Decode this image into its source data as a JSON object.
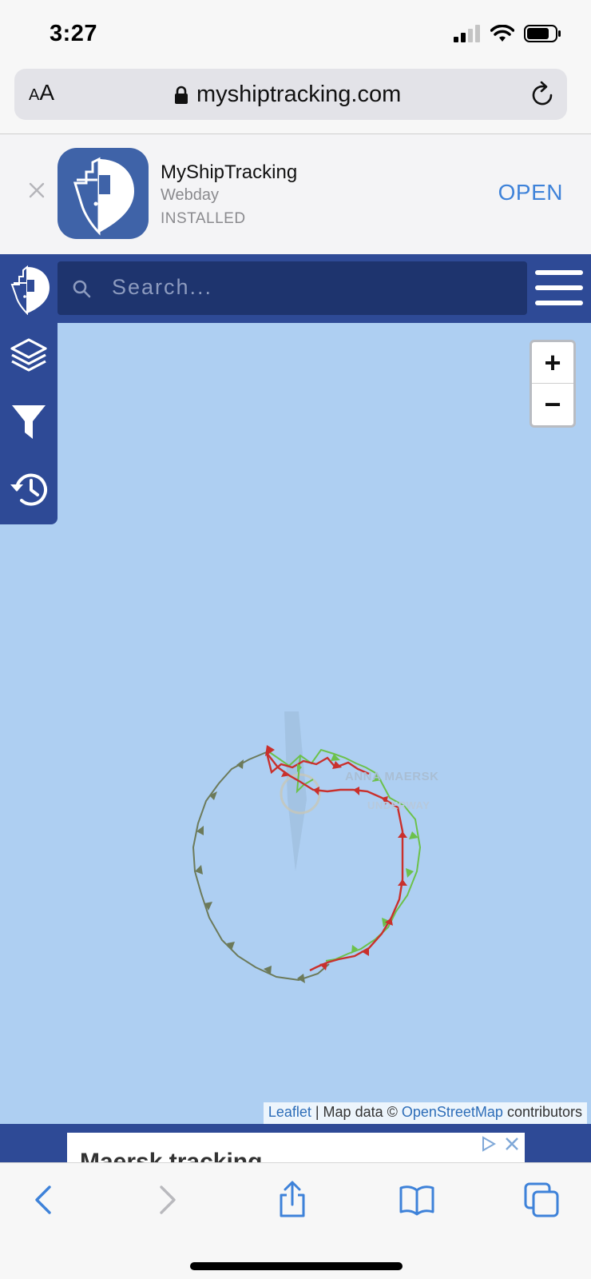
{
  "status_bar": {
    "time": "3:27"
  },
  "browser": {
    "text_size_label": "AA",
    "url": "myshiptracking.com"
  },
  "app_banner": {
    "name": "MyShipTracking",
    "developer": "Webday",
    "status": "INSTALLED",
    "open_label": "OPEN"
  },
  "site_header": {
    "search_placeholder": "Search..."
  },
  "map": {
    "zoom_in": "+",
    "zoom_out": "−",
    "vessel_name": "ANNA MAERSK",
    "vessel_status": "UNDERWAY",
    "attribution": {
      "leaflet": "Leaflet",
      "separator": " | Map data © ",
      "osm": "OpenStreetMap",
      "contributors": " contributors"
    }
  },
  "ad": {
    "title": "Maersk tracking"
  },
  "colors": {
    "header_blue": "#2e4a96",
    "map_water": "#aecff2",
    "track_green": "#6cc14b",
    "track_red": "#c9302c",
    "link_blue": "#2d6db8"
  }
}
